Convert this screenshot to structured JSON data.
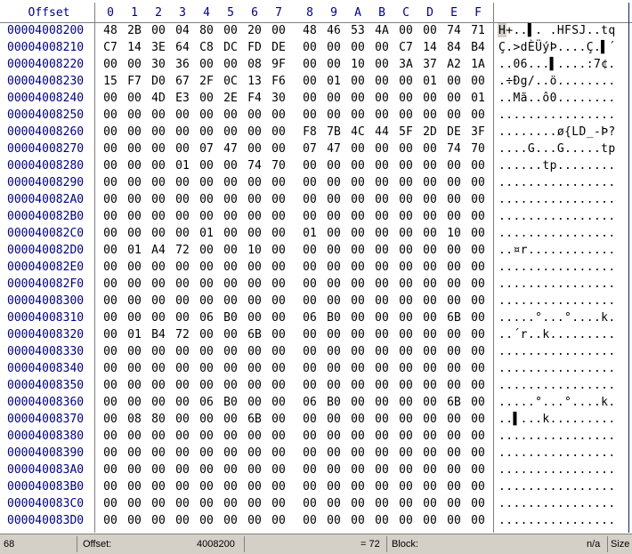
{
  "header": {
    "offset_label": "Offset",
    "columns": [
      "0",
      "1",
      "2",
      "3",
      "4",
      "5",
      "6",
      "7",
      "8",
      "9",
      "A",
      "B",
      "C",
      "D",
      "E",
      "F"
    ]
  },
  "rows": [
    {
      "offset": "00004008200",
      "bytes": [
        "48",
        "2B",
        "00",
        "04",
        "80",
        "00",
        "20",
        "00",
        "48",
        "46",
        "53",
        "4A",
        "00",
        "00",
        "74",
        "71"
      ],
      "ascii": "H+..▌. .HFSJ..tq"
    },
    {
      "offset": "00004008210",
      "bytes": [
        "C7",
        "14",
        "3E",
        "64",
        "C8",
        "DC",
        "FD",
        "DE",
        "00",
        "00",
        "00",
        "00",
        "C7",
        "14",
        "84",
        "B4"
      ],
      "ascii": "Ç.>dÈÜýÞ....Ç.▌´"
    },
    {
      "offset": "00004008220",
      "bytes": [
        "00",
        "00",
        "30",
        "36",
        "00",
        "00",
        "08",
        "9F",
        "00",
        "00",
        "10",
        "00",
        "3A",
        "37",
        "A2",
        "1A"
      ],
      "ascii": "..06...▌....:7¢."
    },
    {
      "offset": "00004008230",
      "bytes": [
        "15",
        "F7",
        "D0",
        "67",
        "2F",
        "0C",
        "13",
        "F6",
        "00",
        "01",
        "00",
        "00",
        "00",
        "01",
        "00",
        "00"
      ],
      "ascii": ".÷Ðg/..ö........"
    },
    {
      "offset": "00004008240",
      "bytes": [
        "00",
        "00",
        "4D",
        "E3",
        "00",
        "2E",
        "F4",
        "30",
        "00",
        "00",
        "00",
        "00",
        "00",
        "00",
        "00",
        "01"
      ],
      "ascii": "..Mã..ô0........"
    },
    {
      "offset": "00004008250",
      "bytes": [
        "00",
        "00",
        "00",
        "00",
        "00",
        "00",
        "00",
        "00",
        "00",
        "00",
        "00",
        "00",
        "00",
        "00",
        "00",
        "00"
      ],
      "ascii": "................"
    },
    {
      "offset": "00004008260",
      "bytes": [
        "00",
        "00",
        "00",
        "00",
        "00",
        "00",
        "00",
        "00",
        "F8",
        "7B",
        "4C",
        "44",
        "5F",
        "2D",
        "DE",
        "3F"
      ],
      "ascii": "........ø{LD_-Þ?"
    },
    {
      "offset": "00004008270",
      "bytes": [
        "00",
        "00",
        "00",
        "00",
        "07",
        "47",
        "00",
        "00",
        "07",
        "47",
        "00",
        "00",
        "00",
        "00",
        "74",
        "70"
      ],
      "ascii": "....G...G.....tp"
    },
    {
      "offset": "00004008280",
      "bytes": [
        "00",
        "00",
        "00",
        "01",
        "00",
        "00",
        "74",
        "70",
        "00",
        "00",
        "00",
        "00",
        "00",
        "00",
        "00",
        "00"
      ],
      "ascii": "......tp........"
    },
    {
      "offset": "00004008290",
      "bytes": [
        "00",
        "00",
        "00",
        "00",
        "00",
        "00",
        "00",
        "00",
        "00",
        "00",
        "00",
        "00",
        "00",
        "00",
        "00",
        "00"
      ],
      "ascii": "................"
    },
    {
      "offset": "000040082A0",
      "bytes": [
        "00",
        "00",
        "00",
        "00",
        "00",
        "00",
        "00",
        "00",
        "00",
        "00",
        "00",
        "00",
        "00",
        "00",
        "00",
        "00"
      ],
      "ascii": "................"
    },
    {
      "offset": "000040082B0",
      "bytes": [
        "00",
        "00",
        "00",
        "00",
        "00",
        "00",
        "00",
        "00",
        "00",
        "00",
        "00",
        "00",
        "00",
        "00",
        "00",
        "00"
      ],
      "ascii": "................"
    },
    {
      "offset": "000040082C0",
      "bytes": [
        "00",
        "00",
        "00",
        "00",
        "01",
        "00",
        "00",
        "00",
        "01",
        "00",
        "00",
        "00",
        "00",
        "00",
        "10",
        "00"
      ],
      "ascii": "................"
    },
    {
      "offset": "000040082D0",
      "bytes": [
        "00",
        "01",
        "A4",
        "72",
        "00",
        "00",
        "10",
        "00",
        "00",
        "00",
        "00",
        "00",
        "00",
        "00",
        "00",
        "00"
      ],
      "ascii": "..¤r............"
    },
    {
      "offset": "000040082E0",
      "bytes": [
        "00",
        "00",
        "00",
        "00",
        "00",
        "00",
        "00",
        "00",
        "00",
        "00",
        "00",
        "00",
        "00",
        "00",
        "00",
        "00"
      ],
      "ascii": "................"
    },
    {
      "offset": "000040082F0",
      "bytes": [
        "00",
        "00",
        "00",
        "00",
        "00",
        "00",
        "00",
        "00",
        "00",
        "00",
        "00",
        "00",
        "00",
        "00",
        "00",
        "00"
      ],
      "ascii": "................"
    },
    {
      "offset": "00004008300",
      "bytes": [
        "00",
        "00",
        "00",
        "00",
        "00",
        "00",
        "00",
        "00",
        "00",
        "00",
        "00",
        "00",
        "00",
        "00",
        "00",
        "00"
      ],
      "ascii": "................"
    },
    {
      "offset": "00004008310",
      "bytes": [
        "00",
        "00",
        "00",
        "00",
        "06",
        "B0",
        "00",
        "00",
        "06",
        "B0",
        "00",
        "00",
        "00",
        "00",
        "6B",
        "00"
      ],
      "ascii": ".....°...°....k."
    },
    {
      "offset": "00004008320",
      "bytes": [
        "00",
        "01",
        "B4",
        "72",
        "00",
        "00",
        "6B",
        "00",
        "00",
        "00",
        "00",
        "00",
        "00",
        "00",
        "00",
        "00"
      ],
      "ascii": "..´r..k........."
    },
    {
      "offset": "00004008330",
      "bytes": [
        "00",
        "00",
        "00",
        "00",
        "00",
        "00",
        "00",
        "00",
        "00",
        "00",
        "00",
        "00",
        "00",
        "00",
        "00",
        "00"
      ],
      "ascii": "................"
    },
    {
      "offset": "00004008340",
      "bytes": [
        "00",
        "00",
        "00",
        "00",
        "00",
        "00",
        "00",
        "00",
        "00",
        "00",
        "00",
        "00",
        "00",
        "00",
        "00",
        "00"
      ],
      "ascii": "................"
    },
    {
      "offset": "00004008350",
      "bytes": [
        "00",
        "00",
        "00",
        "00",
        "00",
        "00",
        "00",
        "00",
        "00",
        "00",
        "00",
        "00",
        "00",
        "00",
        "00",
        "00"
      ],
      "ascii": "................"
    },
    {
      "offset": "00004008360",
      "bytes": [
        "00",
        "00",
        "00",
        "00",
        "06",
        "B0",
        "00",
        "00",
        "06",
        "B0",
        "00",
        "00",
        "00",
        "00",
        "6B",
        "00"
      ],
      "ascii": ".....°...°....k."
    },
    {
      "offset": "00004008370",
      "bytes": [
        "00",
        "08",
        "80",
        "00",
        "00",
        "00",
        "6B",
        "00",
        "00",
        "00",
        "00",
        "00",
        "00",
        "00",
        "00",
        "00"
      ],
      "ascii": "..▌...k........."
    },
    {
      "offset": "00004008380",
      "bytes": [
        "00",
        "00",
        "00",
        "00",
        "00",
        "00",
        "00",
        "00",
        "00",
        "00",
        "00",
        "00",
        "00",
        "00",
        "00",
        "00"
      ],
      "ascii": "................"
    },
    {
      "offset": "00004008390",
      "bytes": [
        "00",
        "00",
        "00",
        "00",
        "00",
        "00",
        "00",
        "00",
        "00",
        "00",
        "00",
        "00",
        "00",
        "00",
        "00",
        "00"
      ],
      "ascii": "................"
    },
    {
      "offset": "000040083A0",
      "bytes": [
        "00",
        "00",
        "00",
        "00",
        "00",
        "00",
        "00",
        "00",
        "00",
        "00",
        "00",
        "00",
        "00",
        "00",
        "00",
        "00"
      ],
      "ascii": "................"
    },
    {
      "offset": "000040083B0",
      "bytes": [
        "00",
        "00",
        "00",
        "00",
        "00",
        "00",
        "00",
        "00",
        "00",
        "00",
        "00",
        "00",
        "00",
        "00",
        "00",
        "00"
      ],
      "ascii": "................"
    },
    {
      "offset": "000040083C0",
      "bytes": [
        "00",
        "00",
        "00",
        "00",
        "00",
        "00",
        "00",
        "00",
        "00",
        "00",
        "00",
        "00",
        "00",
        "00",
        "00",
        "00"
      ],
      "ascii": "................"
    },
    {
      "offset": "000040083D0",
      "bytes": [
        "00",
        "00",
        "00",
        "00",
        "00",
        "00",
        "00",
        "00",
        "00",
        "00",
        "00",
        "00",
        "00",
        "00",
        "00",
        "00"
      ],
      "ascii": "................"
    }
  ],
  "statusbar": {
    "position": "68",
    "offset_label": "Offset:",
    "offset_value": "4008200",
    "decimal_value": "= 72",
    "block_label": "Block:",
    "block_value": "n/a",
    "size_label": "Size"
  },
  "colors": {
    "offset_text": "#000080",
    "byte_text": "#000000",
    "statusbar_bg": "#d4d0c8"
  }
}
